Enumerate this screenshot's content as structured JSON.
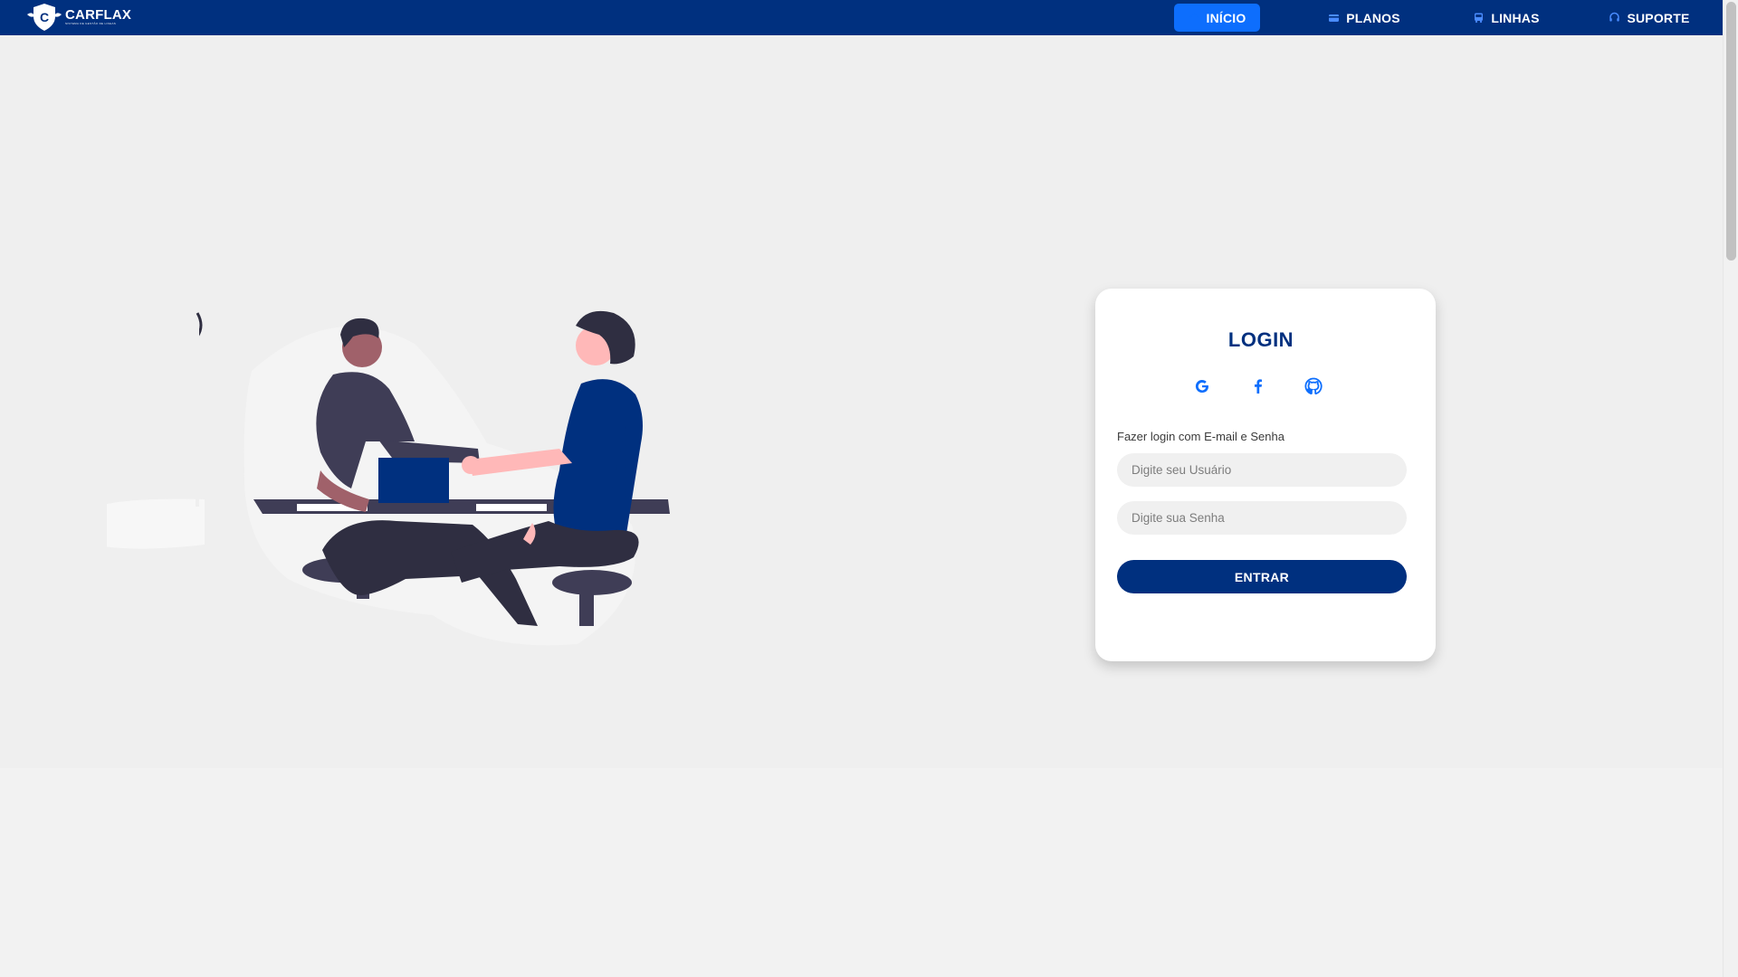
{
  "brand": {
    "name": "CARFLAX",
    "tagline": "SISTEMA DE GESTÃO DE LINHAS"
  },
  "nav": {
    "items": [
      {
        "label": "INÍCIO",
        "icon": "home-icon",
        "active": true
      },
      {
        "label": "PLANOS",
        "icon": "card-icon",
        "active": false
      },
      {
        "label": "LINHAS",
        "icon": "bus-icon",
        "active": false
      },
      {
        "label": "SUPORTE",
        "icon": "headset-icon",
        "active": false
      }
    ]
  },
  "login": {
    "title": "LOGIN",
    "social": [
      "google-icon",
      "facebook-icon",
      "github-icon"
    ],
    "form_label": "Fazer login com E-mail e Senha",
    "user_placeholder": "Digite seu Usuário",
    "password_placeholder": "Digite sua Senha",
    "submit_label": "ENTRAR"
  },
  "colors": {
    "primary": "#00307f",
    "accent": "#0d6efd",
    "background": "#efefef"
  }
}
